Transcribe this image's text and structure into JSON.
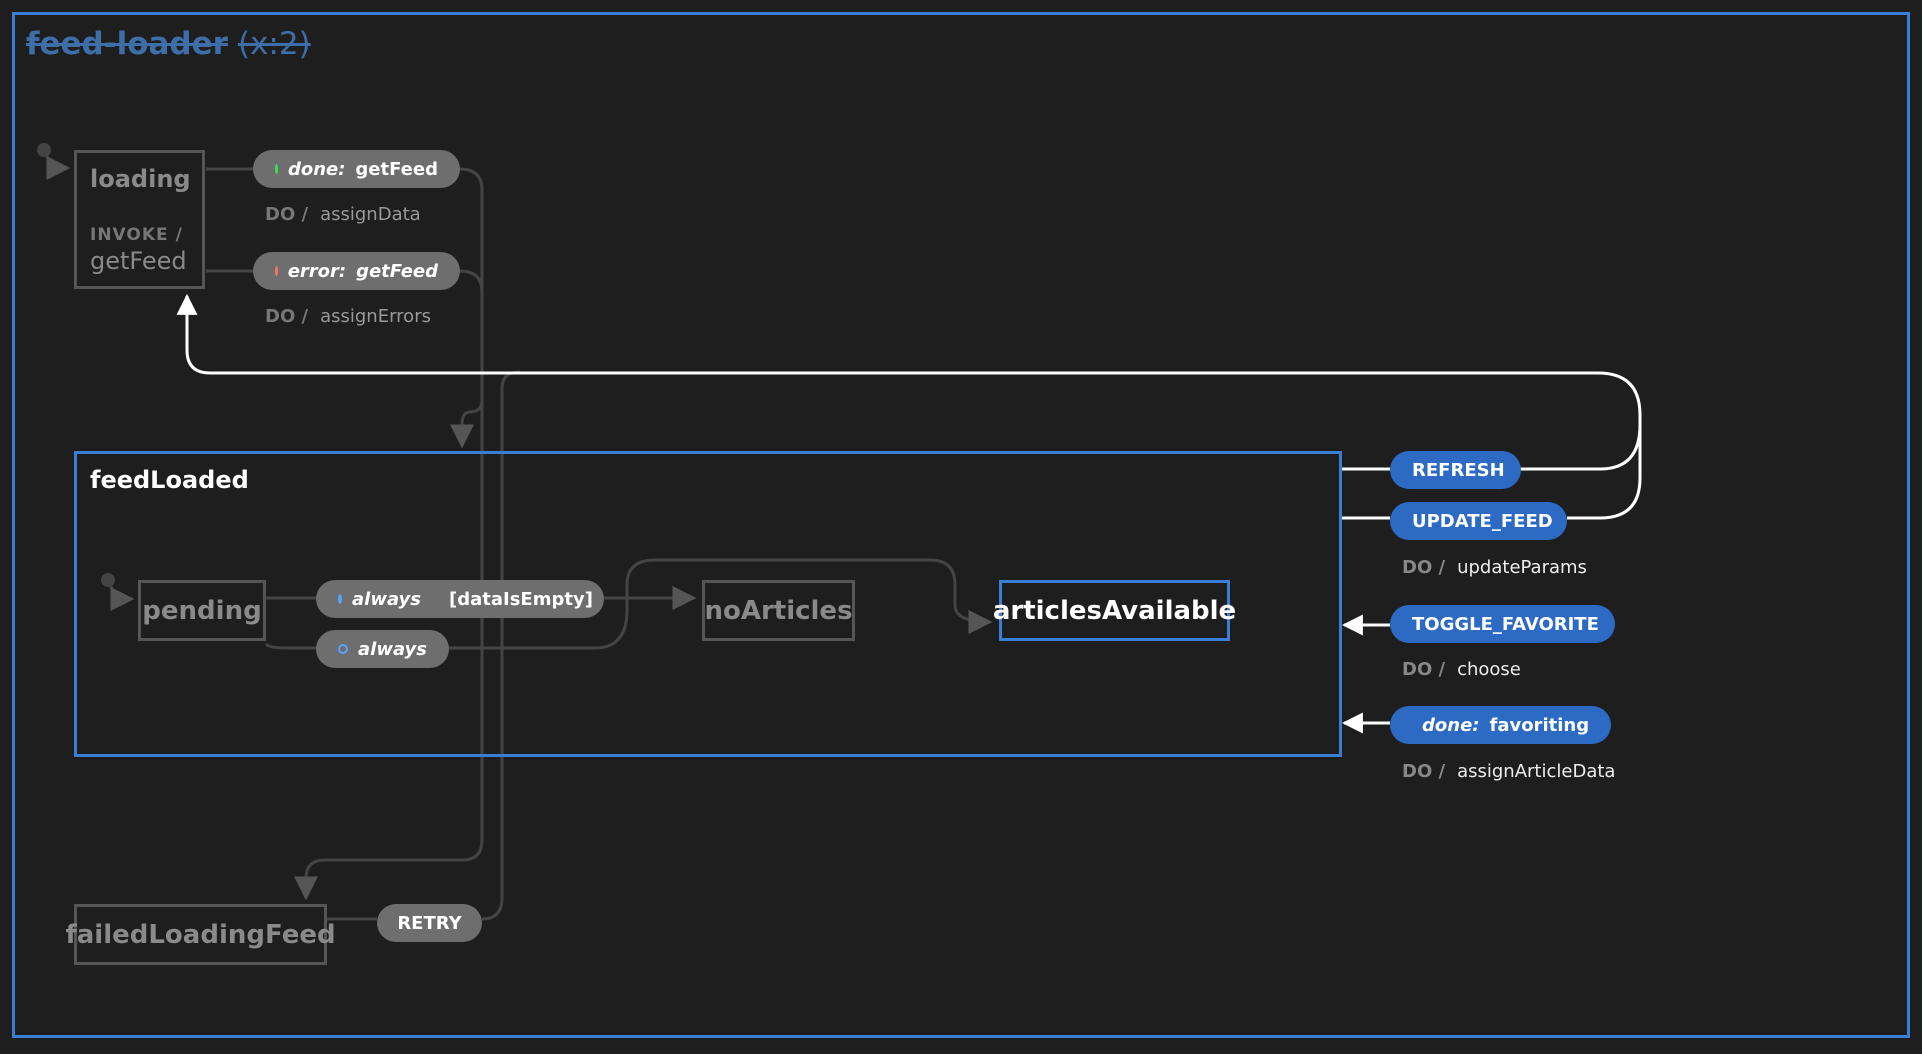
{
  "machine": {
    "id": "feed-loader",
    "count_label": "(x:2)"
  },
  "states": {
    "loading": {
      "label": "loading",
      "invoke_keyword": "INVOKE /",
      "invoke_src": "getFeed"
    },
    "feedLoaded": {
      "label": "feedLoaded"
    },
    "pending": {
      "label": "pending"
    },
    "noArticles": {
      "label": "noArticles"
    },
    "articlesAvailable": {
      "label": "articlesAvailable"
    },
    "failedLoadingFeed": {
      "label": "failedLoadingFeed"
    }
  },
  "transitions": {
    "done_getFeed": {
      "kind": "done:",
      "target": "getFeed",
      "action_kw": "DO /",
      "action": "assignData"
    },
    "error_getFeed": {
      "kind": "error:",
      "target": "getFeed",
      "action_kw": "DO /",
      "action": "assignErrors"
    },
    "always_1": {
      "kind": "always",
      "guard": "[dataIsEmpty]"
    },
    "always_2": {
      "kind": "always"
    },
    "retry": {
      "label": "RETRY"
    },
    "refresh": {
      "label": "REFRESH"
    },
    "update_feed": {
      "label": "UPDATE_FEED",
      "action_kw": "DO /",
      "action": "updateParams"
    },
    "toggle_favorite": {
      "label": "TOGGLE_FAVORITE",
      "action_kw": "DO /",
      "action": "choose"
    },
    "done_favoriting": {
      "kind": "done:",
      "target": "favoriting",
      "action_kw": "DO /",
      "action": "assignArticleData"
    }
  },
  "colors": {
    "active": "#3a7fd6",
    "event_blue": "#2c6ac4",
    "event_grey": "#6e6e6e",
    "done_dot": "#3ee05a",
    "error_dot": "#f07a6a"
  }
}
